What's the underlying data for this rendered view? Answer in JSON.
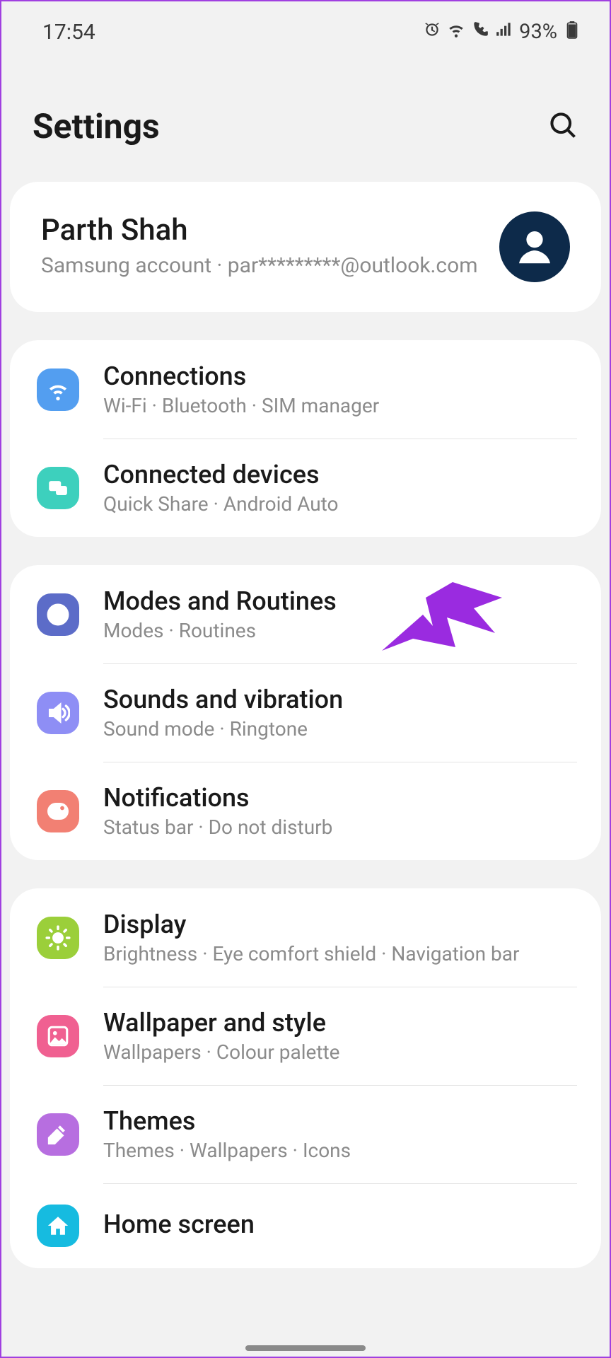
{
  "status": {
    "time": "17:54",
    "battery": "93%"
  },
  "header": {
    "title": "Settings"
  },
  "account": {
    "name": "Parth Shah",
    "subtitle": "Samsung account  ·  par*********@outlook.com"
  },
  "icon_colors": {
    "connections": "#539ef0",
    "connected": "#3dd0bd",
    "modes": "#5c6cc8",
    "sounds": "#8e8ef5",
    "notifications": "#f28073",
    "display": "#9bcf3a",
    "wallpaper": "#f06091",
    "themes": "#b76ee0",
    "home": "#16bbe0"
  },
  "groups": [
    {
      "items": [
        {
          "id": "connections",
          "title": "Connections",
          "sub": "Wi-Fi  ·  Bluetooth  ·  SIM manager"
        },
        {
          "id": "connected",
          "title": "Connected devices",
          "sub": "Quick Share  ·  Android Auto"
        }
      ]
    },
    {
      "items": [
        {
          "id": "modes",
          "title": "Modes and Routines",
          "sub": "Modes  ·  Routines"
        },
        {
          "id": "sounds",
          "title": "Sounds and vibration",
          "sub": "Sound mode  ·  Ringtone"
        },
        {
          "id": "notifications",
          "title": "Notifications",
          "sub": "Status bar  ·  Do not disturb"
        }
      ]
    },
    {
      "items": [
        {
          "id": "display",
          "title": "Display",
          "sub": "Brightness  ·  Eye comfort shield  ·  Navigation bar"
        },
        {
          "id": "wallpaper",
          "title": "Wallpaper and style",
          "sub": "Wallpapers  ·  Colour palette"
        },
        {
          "id": "themes",
          "title": "Themes",
          "sub": "Themes  ·  Wallpapers  ·  Icons"
        },
        {
          "id": "home",
          "title": "Home screen",
          "sub": ""
        }
      ]
    }
  ]
}
